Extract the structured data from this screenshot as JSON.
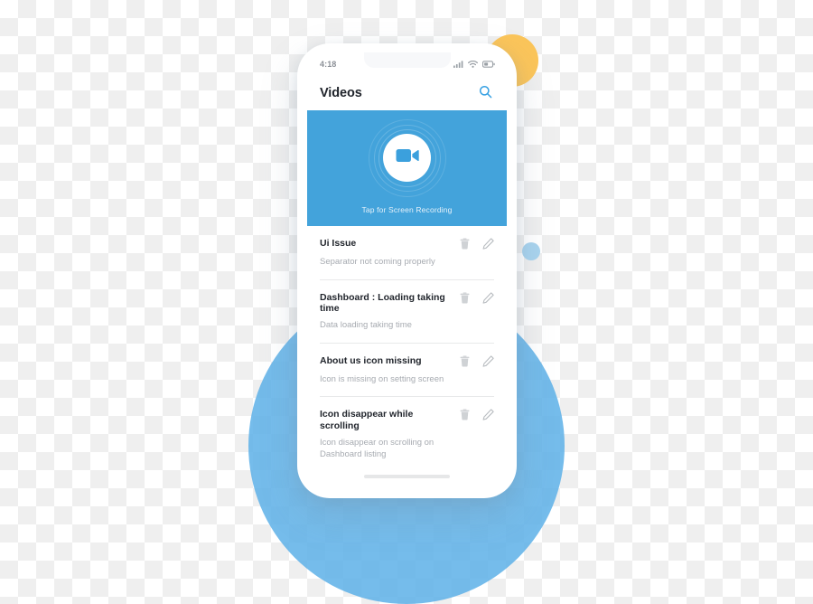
{
  "scene": {
    "decor": {
      "large_circle_color": "#62b3e8",
      "yellow_circle_color": "#fbc55a",
      "small_dot_color": "#a8d3ee"
    }
  },
  "phone": {
    "status_bar": {
      "time": "4:18",
      "icons": [
        "signal-icon",
        "wifi-icon",
        "battery-icon"
      ]
    },
    "header": {
      "title": "Videos",
      "search_icon": "search-icon",
      "accent_color": "#38a1e3"
    },
    "banner": {
      "caption": "Tap for Screen Recording",
      "icon": "video-camera-icon",
      "background_color": "#43a3db"
    },
    "issues": [
      {
        "title": "Ui Issue",
        "description": "Separator not coming properly",
        "delete_icon": "trash-icon",
        "edit_icon": "pencil-icon"
      },
      {
        "title": "Dashboard : Loading taking time",
        "description": "Data loading taking time",
        "delete_icon": "trash-icon",
        "edit_icon": "pencil-icon"
      },
      {
        "title": "About us icon missing",
        "description": "Icon is missing on setting screen",
        "delete_icon": "trash-icon",
        "edit_icon": "pencil-icon"
      },
      {
        "title": "Icon disappear while scrolling",
        "description": "Icon disappear on scrolling on Dashboard listing",
        "delete_icon": "trash-icon",
        "edit_icon": "pencil-icon"
      }
    ]
  }
}
